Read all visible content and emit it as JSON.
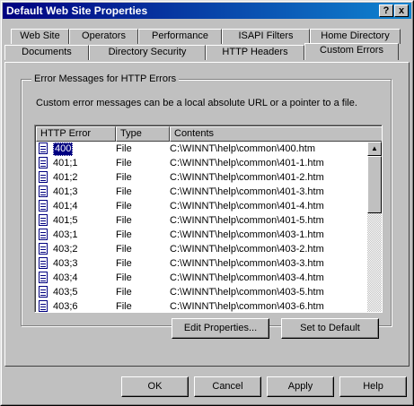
{
  "window": {
    "title": "Default Web Site Properties",
    "help_button": "?",
    "close_button": "x"
  },
  "tabs_row1": [
    "Web Site",
    "Operators",
    "Performance",
    "ISAPI Filters",
    "Home Directory"
  ],
  "tabs_row2": [
    "Documents",
    "Directory Security",
    "HTTP Headers",
    "Custom Errors"
  ],
  "active_tab": "Custom Errors",
  "group": {
    "label": "Error Messages for HTTP Errors",
    "description": "Custom error messages can be a local absolute URL or a pointer to a file."
  },
  "list": {
    "columns": [
      "HTTP Error",
      "Type",
      "Contents"
    ],
    "rows": [
      {
        "error": "400",
        "type": "File",
        "contents": "C:\\WINNT\\help\\common\\400.htm"
      },
      {
        "error": "401;1",
        "type": "File",
        "contents": "C:\\WINNT\\help\\common\\401-1.htm"
      },
      {
        "error": "401;2",
        "type": "File",
        "contents": "C:\\WINNT\\help\\common\\401-2.htm"
      },
      {
        "error": "401;3",
        "type": "File",
        "contents": "C:\\WINNT\\help\\common\\401-3.htm"
      },
      {
        "error": "401;4",
        "type": "File",
        "contents": "C:\\WINNT\\help\\common\\401-4.htm"
      },
      {
        "error": "401;5",
        "type": "File",
        "contents": "C:\\WINNT\\help\\common\\401-5.htm"
      },
      {
        "error": "403;1",
        "type": "File",
        "contents": "C:\\WINNT\\help\\common\\403-1.htm"
      },
      {
        "error": "403;2",
        "type": "File",
        "contents": "C:\\WINNT\\help\\common\\403-2.htm"
      },
      {
        "error": "403;3",
        "type": "File",
        "contents": "C:\\WINNT\\help\\common\\403-3.htm"
      },
      {
        "error": "403;4",
        "type": "File",
        "contents": "C:\\WINNT\\help\\common\\403-4.htm"
      },
      {
        "error": "403;5",
        "type": "File",
        "contents": "C:\\WINNT\\help\\common\\403-5.htm"
      },
      {
        "error": "403;6",
        "type": "File",
        "contents": "C:\\WINNT\\help\\common\\403-6.htm"
      }
    ],
    "selected_index": 0
  },
  "panel_buttons": {
    "edit_properties": "Edit Properties...",
    "set_to_default": "Set to Default"
  },
  "dialog_buttons": {
    "ok": "OK",
    "cancel": "Cancel",
    "apply": "Apply",
    "help": "Help"
  },
  "colors": {
    "title_bar": "#000080",
    "selection": "#000080",
    "face": "#c0c0c0"
  }
}
